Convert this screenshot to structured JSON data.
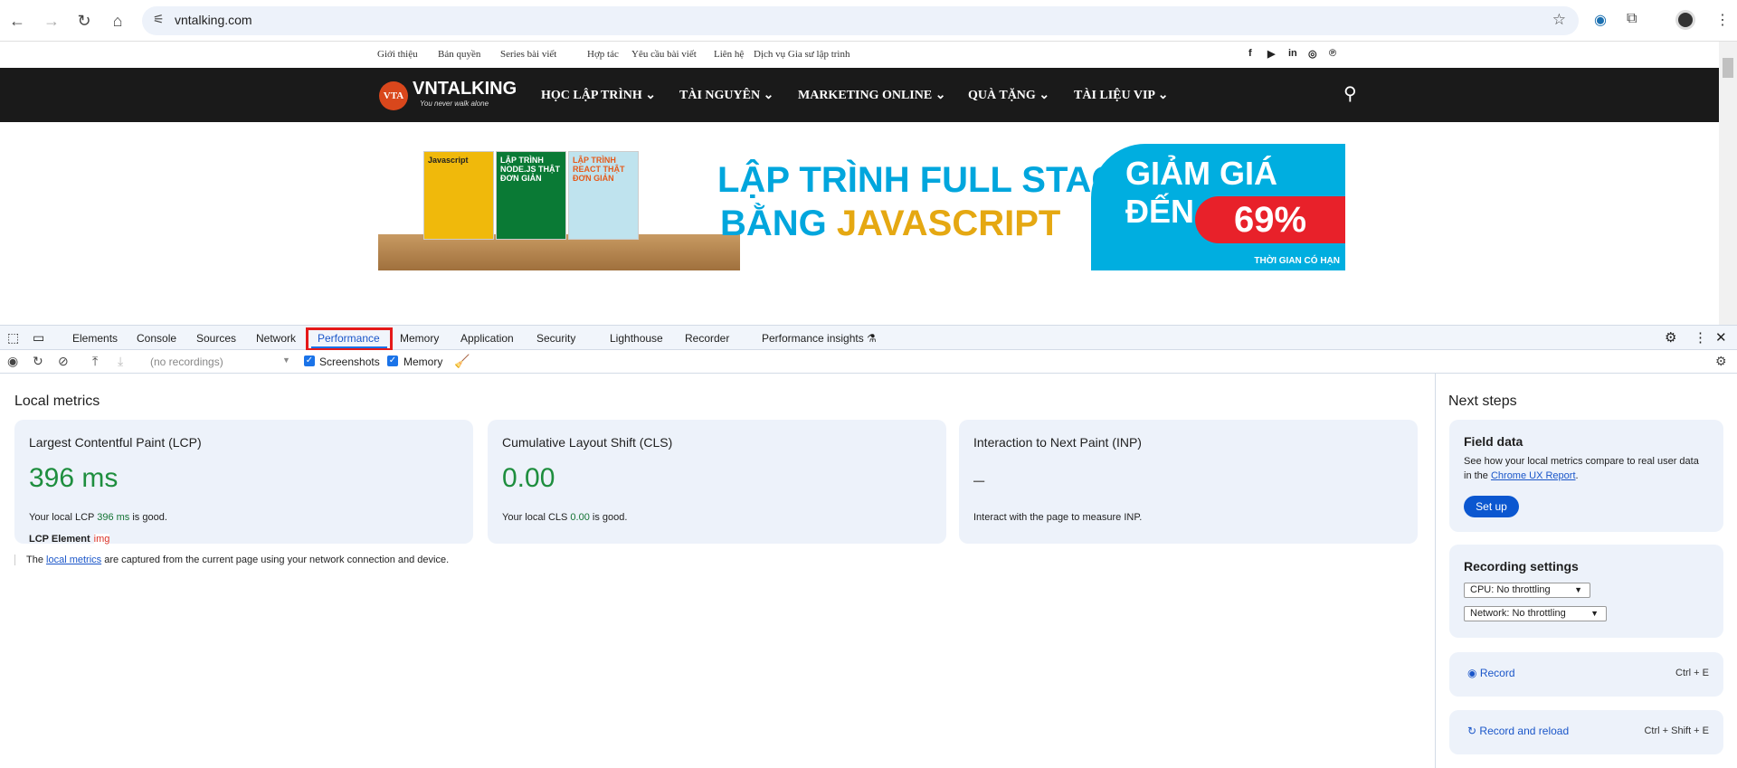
{
  "browser": {
    "url": "vntalking.com",
    "icons": [
      "back-icon",
      "forward-icon",
      "reload-icon",
      "home-icon",
      "site-info-icon",
      "bookmark-star-icon",
      "extension-icon",
      "puzzle-icon",
      "avatar",
      "kebab-menu-icon"
    ]
  },
  "site": {
    "top_links": [
      "Giới thiệu",
      "Bản quyền",
      "Series bài viết",
      "Hợp tác",
      "Yêu cầu bài viết",
      "Liên hệ",
      "Dịch vụ Gia sư lập trình"
    ],
    "social": [
      "f",
      "▶",
      "in",
      "◎",
      "℗"
    ],
    "logo": {
      "mark": "VTA",
      "name": "VNTALKING",
      "tagline": "You never walk alone"
    },
    "nav": [
      "HỌC LẬP TRÌNH",
      "TÀI NGUYÊN",
      "MARKETING ONLINE",
      "QUÀ TẶNG",
      "TÀI LIỆU VIP"
    ],
    "banner": {
      "books": [
        "Javascript",
        "LẬP TRÌNH NODE.JS THẬT ĐƠN GIẢN",
        "LẬP TRÌNH REACT THẬT ĐƠN GIẢN"
      ],
      "line1": "LẬP TRÌNH FULL STACK",
      "line2a": "BẰNG ",
      "line2b": "JAVASCRIPT",
      "promo": "GIẢM GIÁ ĐẾN",
      "percent": "69%",
      "limited": "THỜI GIAN CÓ HẠN"
    }
  },
  "devtools": {
    "tabs": [
      "Elements",
      "Console",
      "Sources",
      "Network",
      "Performance",
      "Memory",
      "Application",
      "Security",
      "Lighthouse",
      "Recorder",
      "Performance insights ⚗"
    ],
    "active_tab": "Performance",
    "toolbar": {
      "recordings_placeholder": "(no recordings)",
      "screenshots": "Screenshots",
      "memory": "Memory",
      "screenshots_checked": true,
      "memory_checked": true
    },
    "local_metrics": {
      "title": "Local metrics",
      "cards": [
        {
          "title": "Largest Contentful Paint (LCP)",
          "value": "396 ms",
          "desc_pre": "Your local LCP ",
          "desc_val": "396 ms",
          "desc_post": " is good.",
          "element_label": "LCP Element",
          "element": "img"
        },
        {
          "title": "Cumulative Layout Shift (CLS)",
          "value": "0.00",
          "desc_pre": "Your local CLS ",
          "desc_val": "0.00",
          "desc_post": " is good."
        },
        {
          "title": "Interaction to Next Paint (INP)",
          "value": "–",
          "desc": "Interact with the page to measure INP."
        }
      ],
      "footnote_pre": "The ",
      "footnote_link": "local metrics",
      "footnote_post": " are captured from the current page using your network connection and device."
    },
    "next_steps": {
      "title": "Next steps",
      "field_data": {
        "title": "Field data",
        "text": "See how your local metrics compare to real user data in the ",
        "link": "Chrome UX Report",
        "end": ".",
        "button": "Set up"
      },
      "recording_settings": {
        "title": "Recording settings",
        "cpu": "CPU: No throttling",
        "network": "Network: No throttling"
      },
      "record": {
        "label": "Record",
        "shortcut": "Ctrl + E"
      },
      "record_reload": {
        "label": "Record and reload",
        "shortcut": "Ctrl + Shift + E"
      }
    }
  }
}
